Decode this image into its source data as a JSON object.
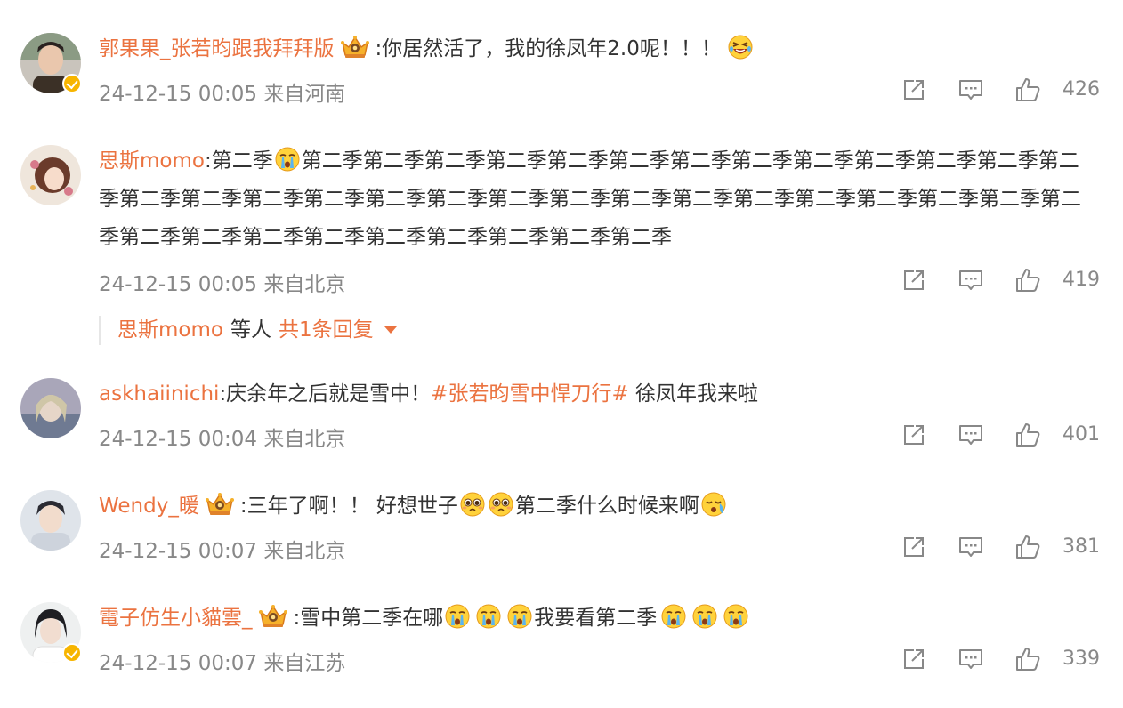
{
  "comments": [
    {
      "username": "郭果果_张若昀跟我拜拜版",
      "verified": true,
      "crown": true,
      "content": ":你居然活了，我的徐凤年2.0呢！！！",
      "emoji_after": "laugh-cry-emoji",
      "time": "24-12-15 00:05",
      "location": "来自河南",
      "likes": "426"
    },
    {
      "username": "思斯momo",
      "verified": false,
      "crown": false,
      "content_before_emoji": ":第二季",
      "emoji": "crying-emoji",
      "content_after_emoji": "第二季第二季第二季第二季第二季第二季第二季第二季第二季第二季第二季第二季第二季第二季第二季第二季第二季第二季第二季第二季第二季第二季第二季第二季第二季第二季第二季第二季第二季第二季第二季第二季第二季第二季第二季第二季第二季第二季",
      "time": "24-12-15 00:05",
      "location": "来自北京",
      "likes": "419",
      "reply_summary": {
        "user": "思斯momo",
        "others": "等人",
        "count_text": "共1条回复"
      }
    },
    {
      "username": "askhaiinichi",
      "verified": false,
      "crown": false,
      "content_before": ":庆余年之后就是雪中！",
      "topic": "#张若昀雪中悍刀行#",
      "content_after": " 徐凤年我来啦",
      "time": "24-12-15 00:04",
      "location": "来自北京",
      "likes": "401"
    },
    {
      "username": "Wendy_暖",
      "verified": false,
      "crown": true,
      "content_part1": ":三年了啊！！ 好想世子",
      "emoji1": "pleading-emoji",
      "content_part2": "第二季什么时候来啊",
      "emoji2": "sob-emoji",
      "time": "24-12-15 00:07",
      "location": "来自北京",
      "likes": "381"
    },
    {
      "username": "電子仿生小貓雲_",
      "verified": true,
      "crown": true,
      "content_part1": ":雪中第二季在哪",
      "content_part2": "我要看第二季",
      "emoji": "crying-emoji",
      "time": "24-12-15 00:07",
      "location": "来自江苏",
      "likes": "339"
    }
  ],
  "icons": {
    "share": "share-icon",
    "comment": "comment-icon",
    "like": "like-icon",
    "expand": "triangle-down-icon"
  },
  "colors": {
    "username": "#eb7340",
    "meta": "#888888",
    "text": "#333333",
    "badge": "#f7b500"
  }
}
